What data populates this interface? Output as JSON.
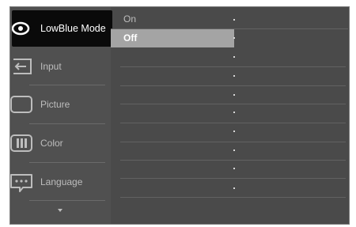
{
  "menu": {
    "items": [
      {
        "label": "LowBlue Mode",
        "icon": "eye-icon",
        "active": true
      },
      {
        "label": "Input",
        "icon": "input-icon",
        "active": false
      },
      {
        "label": "Picture",
        "icon": "picture-icon",
        "active": false
      },
      {
        "label": "Color",
        "icon": "color-icon",
        "active": false
      },
      {
        "label": "Language",
        "icon": "language-icon",
        "active": false
      }
    ],
    "more_icon": "chevron-down-icon"
  },
  "options": {
    "items": [
      {
        "label": "On",
        "selected": false
      },
      {
        "label": "Off",
        "selected": true
      }
    ]
  },
  "colors": {
    "osd_background": "#4a4a4a",
    "active_menu_background": "#0a0a0a",
    "selected_option_background": "#a4a4a4",
    "text": "#bdbdbd",
    "active_text": "#ffffff"
  }
}
